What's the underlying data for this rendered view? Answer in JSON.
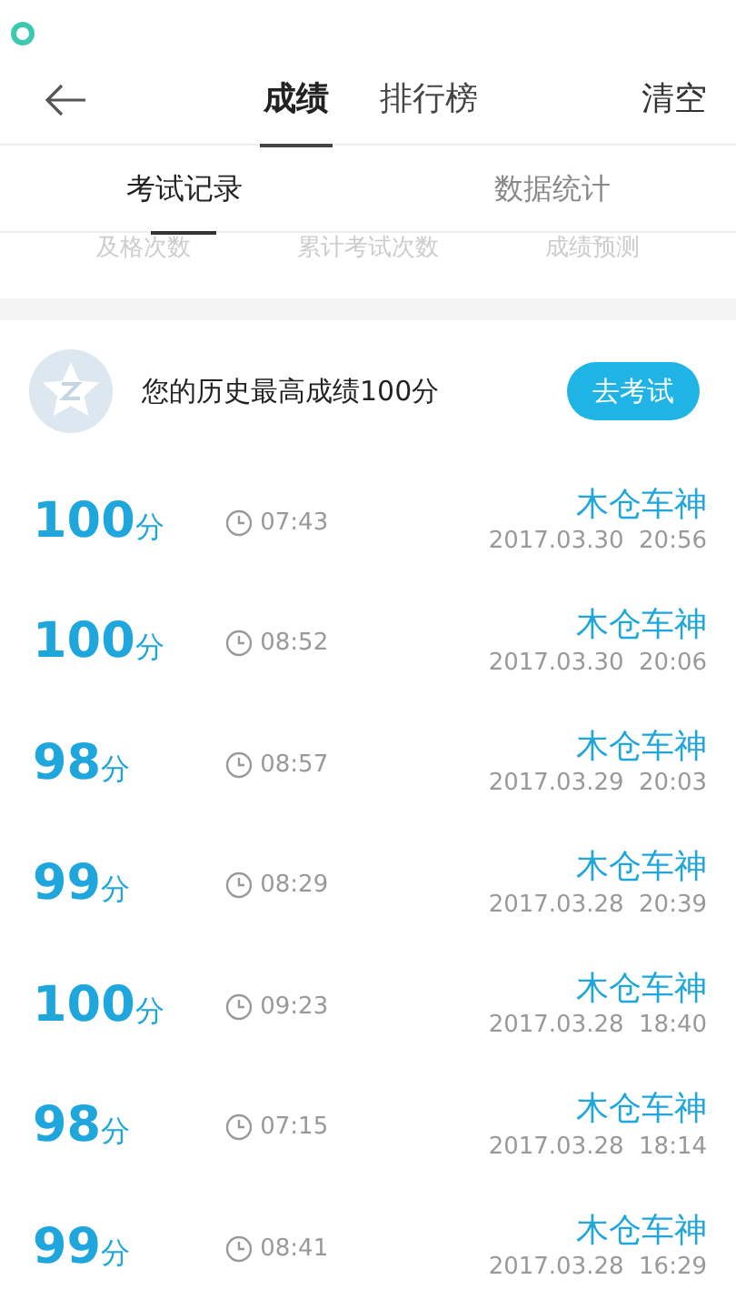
{
  "header": {
    "tabs": [
      {
        "label": "成绩",
        "selected": true
      },
      {
        "label": "排行榜",
        "selected": false
      }
    ],
    "action": "清空"
  },
  "subtabs": [
    {
      "label": "考试记录",
      "selected": true
    },
    {
      "label": "数据统计",
      "selected": false
    }
  ],
  "stats_labels": [
    "及格次数",
    "累计考试次数",
    "成绩预测"
  ],
  "best": {
    "text": "您的历史最高成绩100分",
    "button": "去考试"
  },
  "records": [
    {
      "score": "100",
      "unit": "分",
      "duration": "07:43",
      "name": "木仓车神",
      "datetime": "2017.03.30  20:56"
    },
    {
      "score": "100",
      "unit": "分",
      "duration": "08:52",
      "name": "木仓车神",
      "datetime": "2017.03.30  20:06"
    },
    {
      "score": "98",
      "unit": "分",
      "duration": "08:57",
      "name": "木仓车神",
      "datetime": "2017.03.29  20:03"
    },
    {
      "score": "99",
      "unit": "分",
      "duration": "08:29",
      "name": "木仓车神",
      "datetime": "2017.03.28  20:39"
    },
    {
      "score": "100",
      "unit": "分",
      "duration": "09:23",
      "name": "木仓车神",
      "datetime": "2017.03.28  18:40"
    },
    {
      "score": "98",
      "unit": "分",
      "duration": "07:15",
      "name": "木仓车神",
      "datetime": "2017.03.28  18:14"
    },
    {
      "score": "99",
      "unit": "分",
      "duration": "08:41",
      "name": "木仓车神",
      "datetime": "2017.03.28  16:29"
    }
  ]
}
